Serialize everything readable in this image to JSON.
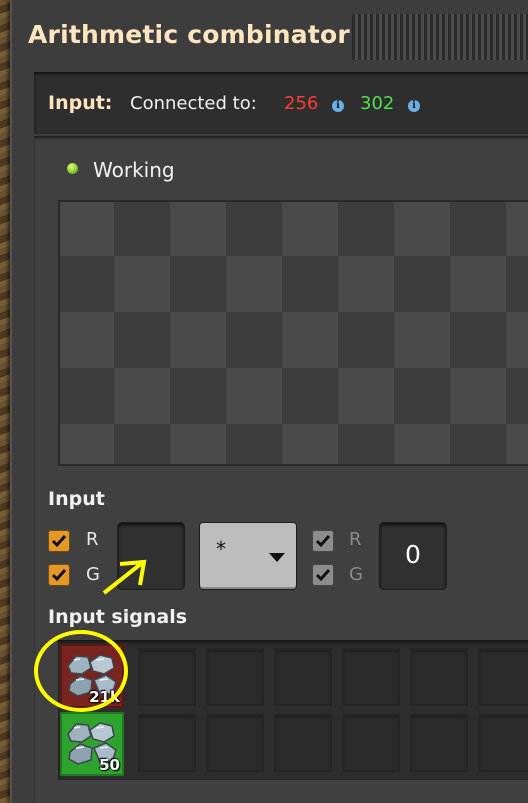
{
  "window": {
    "title": "Arithmetic combinator"
  },
  "connection": {
    "label": "Input:",
    "text": "Connected to:",
    "red_network": "256",
    "green_network": "302",
    "info_symbol": "i"
  },
  "status": {
    "text": "Working",
    "color": "#7ec81e"
  },
  "input_section": {
    "heading": "Input",
    "left_checkboxes": [
      {
        "label": "R",
        "checked": true
      },
      {
        "label": "G",
        "checked": true
      }
    ],
    "first_signal": "",
    "operator": {
      "selected": "*"
    },
    "right_checkboxes": [
      {
        "label": "R",
        "checked": true
      },
      {
        "label": "G",
        "checked": true
      }
    ],
    "constant": "0"
  },
  "input_signals": {
    "heading": "Input signals",
    "items": [
      {
        "icon": "stone-icon",
        "count": "21k",
        "network": "red",
        "color": "#7a2420"
      },
      {
        "icon": "stone-icon",
        "count": "50",
        "network": "green",
        "color": "#2ea32e"
      }
    ]
  },
  "colors": {
    "accent_title": "#ffe6c0",
    "red_wire": "#ff3b3b",
    "green_wire": "#4ee04e",
    "checkbox": "#e39827",
    "annotation": "#ffff00"
  }
}
